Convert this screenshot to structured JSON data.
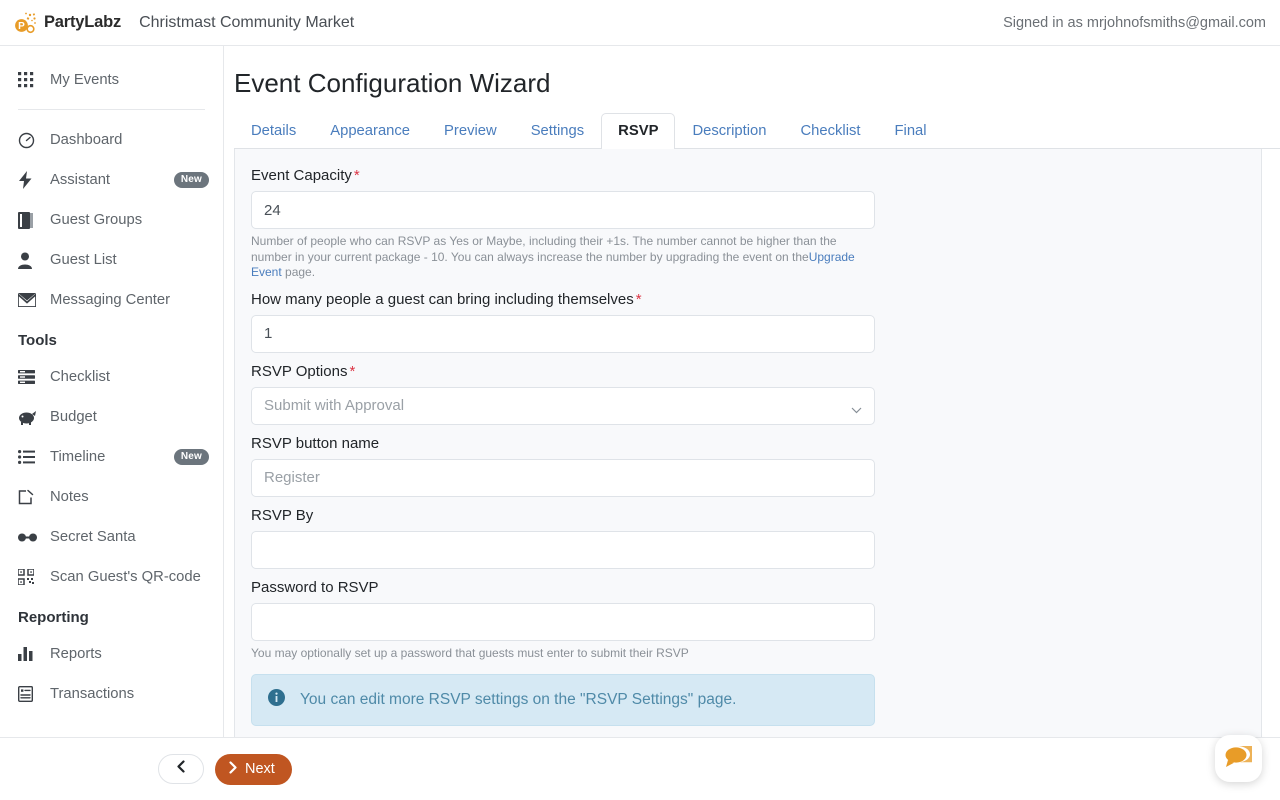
{
  "topbar": {
    "brand_name": "PartyLabz",
    "event_name": "Christmast Community Market",
    "signed_in": "Signed in as mrjohnofsmiths@gmail.com",
    "logo_icon": "party-popper-icon",
    "brand_color": "#e89c28"
  },
  "sidebar": {
    "top_items": [
      {
        "label": "My Events",
        "icon": "grid-icon",
        "badge": ""
      }
    ],
    "main_items": [
      {
        "label": "Dashboard",
        "icon": "gauge-icon",
        "badge": ""
      },
      {
        "label": "Assistant",
        "icon": "bolt-icon",
        "badge": "New"
      },
      {
        "label": "Guest Groups",
        "icon": "book-icon",
        "badge": ""
      },
      {
        "label": "Guest List",
        "icon": "person-icon",
        "badge": ""
      },
      {
        "label": "Messaging Center",
        "icon": "envelope-icon",
        "badge": ""
      }
    ],
    "tools_heading": "Tools",
    "tools_items": [
      {
        "label": "Checklist",
        "icon": "checklist-icon",
        "badge": ""
      },
      {
        "label": "Budget",
        "icon": "piggy-bank-icon",
        "badge": ""
      },
      {
        "label": "Timeline",
        "icon": "list-icon",
        "badge": "New"
      },
      {
        "label": "Notes",
        "icon": "note-edit-icon",
        "badge": ""
      },
      {
        "label": "Secret Santa",
        "icon": "glasses-icon",
        "badge": ""
      },
      {
        "label": "Scan Guest's QR-code",
        "icon": "qr-code-icon",
        "badge": ""
      }
    ],
    "reporting_heading": "Reporting",
    "reporting_items": [
      {
        "label": "Reports",
        "icon": "bar-chart-icon",
        "badge": ""
      },
      {
        "label": "Transactions",
        "icon": "receipt-icon",
        "badge": ""
      }
    ]
  },
  "main": {
    "page_title": "Event Configuration Wizard",
    "tabs": [
      {
        "label": "Details",
        "active": false
      },
      {
        "label": "Appearance",
        "active": false
      },
      {
        "label": "Preview",
        "active": false
      },
      {
        "label": "Settings",
        "active": false
      },
      {
        "label": "RSVP",
        "active": true
      },
      {
        "label": "Description",
        "active": false
      },
      {
        "label": "Checklist",
        "active": false
      },
      {
        "label": "Final",
        "active": false
      }
    ],
    "fields": {
      "capacity": {
        "label": "Event Capacity",
        "required": true,
        "value": "24",
        "help_before": "Number of people who can RSVP as Yes or Maybe, including their +1s. The number cannot be higher than the number in your current package - 10. You can always increase the number by upgrading the event on the",
        "help_link": "Upgrade Event",
        "help_after": " page."
      },
      "plus_ones": {
        "label": "How many people a guest can bring including themselves",
        "required": true,
        "value": "1"
      },
      "rsvp_options": {
        "label": "RSVP Options",
        "required": true,
        "selected": "Submit with Approval",
        "chevron_icon": "chevron-down-icon"
      },
      "button_name": {
        "label": "RSVP button name",
        "required": false,
        "value": "",
        "placeholder": "Register"
      },
      "rsvp_by": {
        "label": "RSVP By",
        "required": false,
        "value": ""
      },
      "password": {
        "label": "Password to RSVP",
        "required": false,
        "value": "",
        "help": "You may optionally set up a password that guests must enter to submit their RSVP"
      }
    },
    "alert": {
      "icon": "info-circle-icon",
      "text": "You can edit more RSVP settings on the \"RSVP Settings\" page."
    }
  },
  "bottombar": {
    "prev_icon": "chevron-left-icon",
    "next_icon": "chevron-right-icon",
    "next_label": "Next",
    "next_color": "#c05621"
  },
  "chat": {
    "icon": "chat-bubbles-icon",
    "color": "#e89c28"
  }
}
